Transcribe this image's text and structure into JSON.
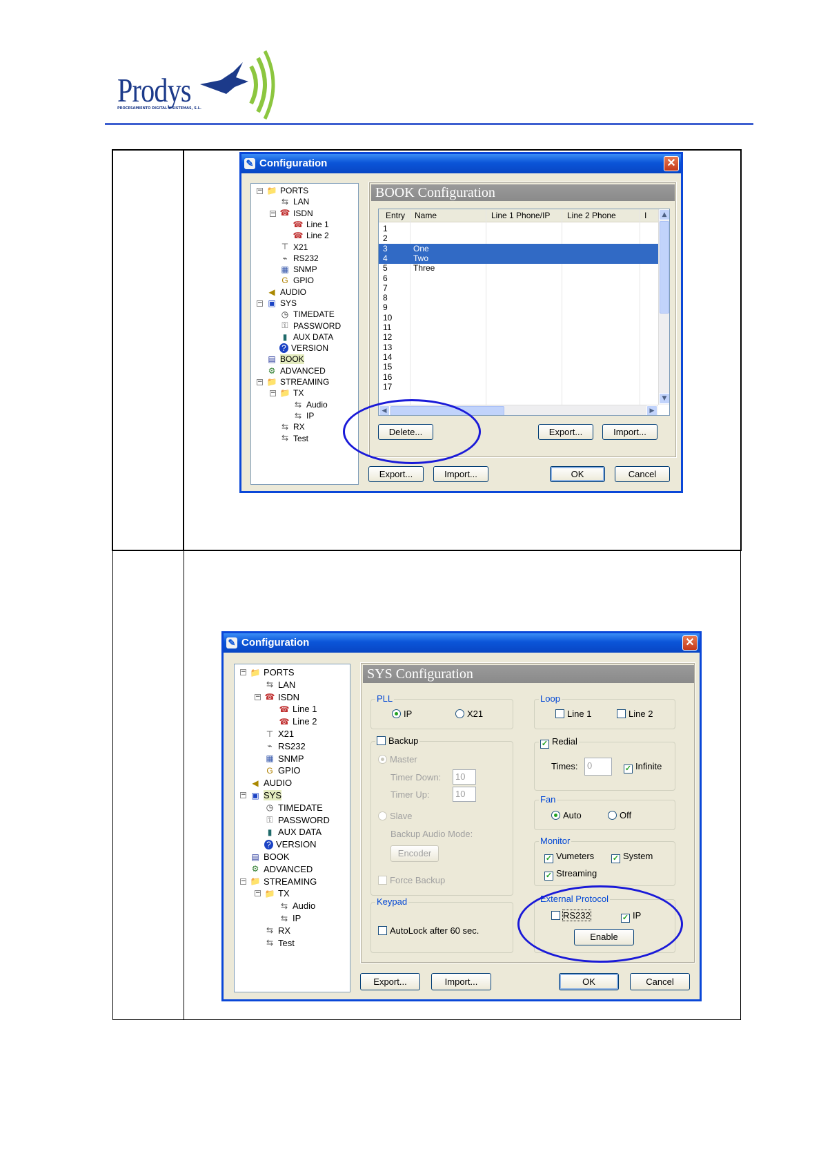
{
  "header": {
    "logo_text": "Prodys",
    "logo_subtext": "PROCESAMIENTO DIGITAL Y SISTEMAS, S.L."
  },
  "colors": {
    "titlebar": "#0b55d8",
    "selection": "#316ac5",
    "annotation": "#1a1ad8",
    "rule": "#3d5fd0"
  },
  "tree": [
    {
      "label": "PORTS",
      "icon": "folder-icon"
    },
    {
      "label": "LAN",
      "icon": "network-icon"
    },
    {
      "label": "ISDN",
      "icon": "phone-icon"
    },
    {
      "label": "Line 1",
      "icon": "phone-icon"
    },
    {
      "label": "Line 2",
      "icon": "phone-icon"
    },
    {
      "label": "X21",
      "icon": "connector-icon"
    },
    {
      "label": "RS232",
      "icon": "cable-icon"
    },
    {
      "label": "SNMP",
      "icon": "server-icon"
    },
    {
      "label": "GPIO",
      "icon": "gpio-icon"
    },
    {
      "label": "AUDIO",
      "icon": "speaker-icon"
    },
    {
      "label": "SYS",
      "icon": "monitor-icon"
    },
    {
      "label": "TIMEDATE",
      "icon": "clock-icon"
    },
    {
      "label": "PASSWORD",
      "icon": "key-icon"
    },
    {
      "label": "AUX DATA",
      "icon": "plug-icon"
    },
    {
      "label": "VERSION",
      "icon": "help-icon"
    },
    {
      "label": "BOOK",
      "icon": "book-icon"
    },
    {
      "label": "ADVANCED",
      "icon": "gears-icon"
    },
    {
      "label": "STREAMING",
      "icon": "folder-icon"
    },
    {
      "label": "TX",
      "icon": "folder-icon"
    },
    {
      "label": "Audio",
      "icon": "network-icon"
    },
    {
      "label": "IP",
      "icon": "network-icon"
    },
    {
      "label": "RX",
      "icon": "network-icon"
    },
    {
      "label": "Test",
      "icon": "network-icon"
    }
  ],
  "book_window": {
    "title": "Configuration",
    "panel_title": "BOOK Configuration",
    "columns": [
      "Entry",
      "Name",
      "Line 1 Phone/IP",
      "Line 2 Phone",
      "I"
    ],
    "rows": [
      {
        "entry": "1",
        "name": ""
      },
      {
        "entry": "2",
        "name": ""
      },
      {
        "entry": "3",
        "name": "One"
      },
      {
        "entry": "4",
        "name": "Two"
      },
      {
        "entry": "5",
        "name": "Three"
      },
      {
        "entry": "6",
        "name": ""
      },
      {
        "entry": "7",
        "name": ""
      },
      {
        "entry": "8",
        "name": ""
      },
      {
        "entry": "9",
        "name": ""
      },
      {
        "entry": "10",
        "name": ""
      },
      {
        "entry": "11",
        "name": ""
      },
      {
        "entry": "12",
        "name": ""
      },
      {
        "entry": "13",
        "name": ""
      },
      {
        "entry": "14",
        "name": ""
      },
      {
        "entry": "15",
        "name": ""
      },
      {
        "entry": "16",
        "name": ""
      },
      {
        "entry": "17",
        "name": ""
      }
    ],
    "delete_label": "Delete...",
    "panel_export_label": "Export...",
    "panel_import_label": "Import...",
    "export_label": "Export...",
    "import_label": "Import...",
    "ok_label": "OK",
    "cancel_label": "Cancel"
  },
  "sys_window": {
    "title": "Configuration",
    "panel_title": "SYS Configuration",
    "pll": {
      "label": "PLL",
      "ip": "IP",
      "x21": "X21"
    },
    "loop": {
      "label": "Loop",
      "line1": "Line 1",
      "line2": "Line 2"
    },
    "backup": {
      "label": "Backup",
      "master": "Master",
      "timer_down": "Timer Down:",
      "timer_down_value": "10",
      "timer_up": "Timer Up:",
      "timer_up_value": "10",
      "slave": "Slave",
      "audio_mode": "Backup Audio Mode:",
      "encoder": "Encoder",
      "force": "Force Backup"
    },
    "redial": {
      "label": "Redial",
      "times": "Times:",
      "times_value": "0",
      "infinite": "Infinite"
    },
    "fan": {
      "label": "Fan",
      "auto": "Auto",
      "off": "Off"
    },
    "monitor": {
      "label": "Monitor",
      "vumeters": "Vumeters",
      "system": "System",
      "streaming": "Streaming"
    },
    "keypad": {
      "label": "Keypad",
      "autolock": "AutoLock after 60 sec."
    },
    "protocol": {
      "label": "External Protocol",
      "rs232": "RS232",
      "ip": "IP",
      "enable": "Enable"
    },
    "export_label": "Export...",
    "import_label": "Import...",
    "ok_label": "OK",
    "cancel_label": "Cancel"
  }
}
